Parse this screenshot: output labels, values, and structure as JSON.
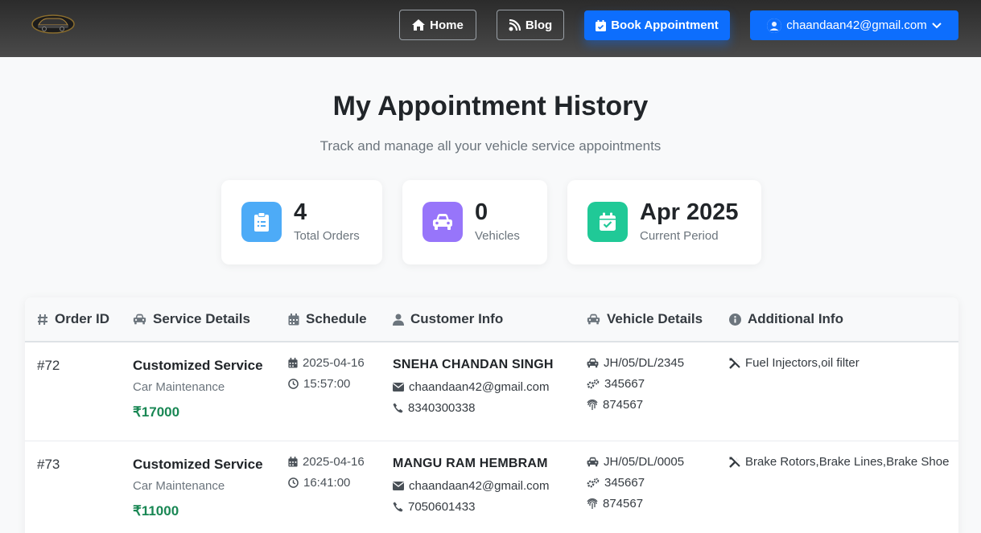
{
  "navbar": {
    "home_label": "Home",
    "blog_label": "Blog",
    "book_label": "Book Appointment",
    "user_email": "chaandaan42@gmail.com"
  },
  "header": {
    "title": "My Appointment History",
    "subtitle": "Track and manage all your vehicle service appointments"
  },
  "stats": [
    {
      "value": "4",
      "label": "Total Orders",
      "icon": "clipboard-icon",
      "color": "#4dabf7"
    },
    {
      "value": "0",
      "label": "Vehicles",
      "icon": "car-icon",
      "color": "#9775fa"
    },
    {
      "value": "Apr 2025",
      "label": "Current Period",
      "icon": "calendar-check-icon",
      "color": "#20c997"
    }
  ],
  "table": {
    "headers": [
      "Order ID",
      "Service Details",
      "Schedule",
      "Customer Info",
      "Vehicle Details",
      "Additional Info"
    ],
    "rows": [
      {
        "order_id": "#72",
        "service_name": "Customized Service",
        "service_type": "Car Maintenance",
        "price": "₹17000",
        "date": "2025-04-16",
        "time": "15:57:00",
        "customer_name": "SNEHA CHANDAN SINGH",
        "email": "chaandaan42@gmail.com",
        "phone": "8340300338",
        "vehicle_number": "JH/05/DL/2345",
        "engine_number": "345667",
        "chassis_number": "874567",
        "additional": "Fuel Injectors,oil filter"
      },
      {
        "order_id": "#73",
        "service_name": "Customized Service",
        "service_type": "Car Maintenance",
        "price": "₹11000",
        "date": "2025-04-16",
        "time": "16:41:00",
        "customer_name": "MANGU RAM HEMBRAM",
        "email": "chaandaan42@gmail.com",
        "phone": "7050601433",
        "vehicle_number": "JH/05/DL/0005",
        "engine_number": "345667",
        "chassis_number": "874567",
        "additional": "Brake Rotors,Brake Lines,Brake Shoe"
      }
    ]
  }
}
